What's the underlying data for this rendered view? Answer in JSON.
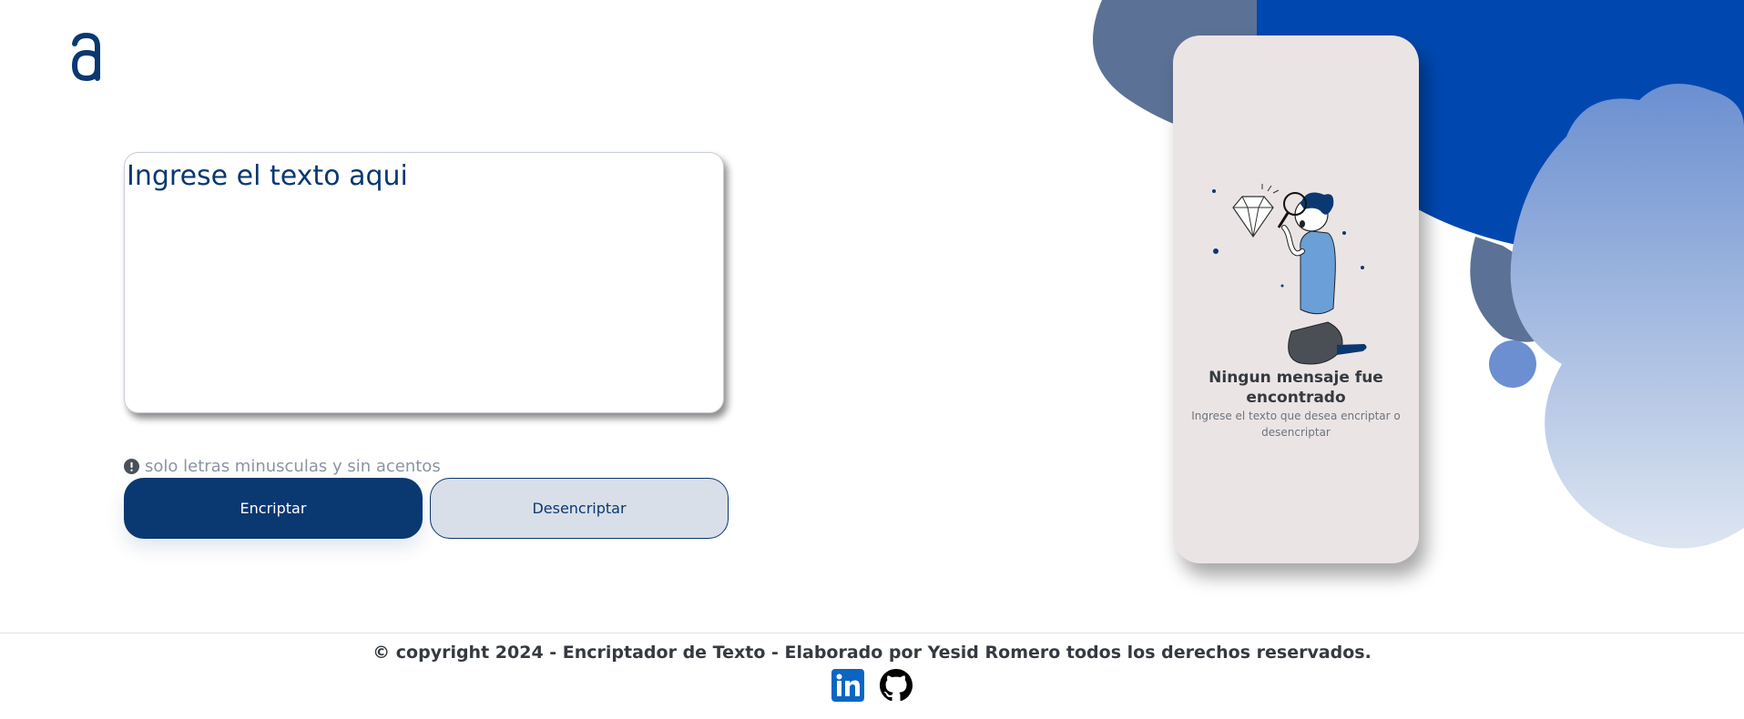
{
  "header": {
    "logo_icon": "alura-a-logo-icon"
  },
  "input": {
    "placeholder": "Ingrese el texto aqui"
  },
  "hint": {
    "icon": "exclamation-circle-icon",
    "text": "solo letras minusculas y sin acentos"
  },
  "buttons": {
    "encrypt_label": "Encriptar",
    "decrypt_label": "Desencriptar"
  },
  "output": {
    "illustration": "person-with-magnifier-and-diamond-illustration",
    "title": "Ningun mensaje fue encontrado",
    "subtitle": "Ingrese el texto que desea encriptar o desencriptar"
  },
  "footer": {
    "copyright": "© copyright 2024 - Encriptador de Texto - Elaborado por Yesid Romero todos los derechos reservados.",
    "social": [
      {
        "name": "linkedin-icon"
      },
      {
        "name": "github-icon"
      }
    ]
  },
  "colors": {
    "primary": "#0a3871",
    "secondary_bg": "#d8dfe8",
    "phone_bg": "#ebe4e5",
    "blob_dark": "#0048b0",
    "blob_slate": "#5c7196",
    "blob_light": "#6a8fcf"
  }
}
